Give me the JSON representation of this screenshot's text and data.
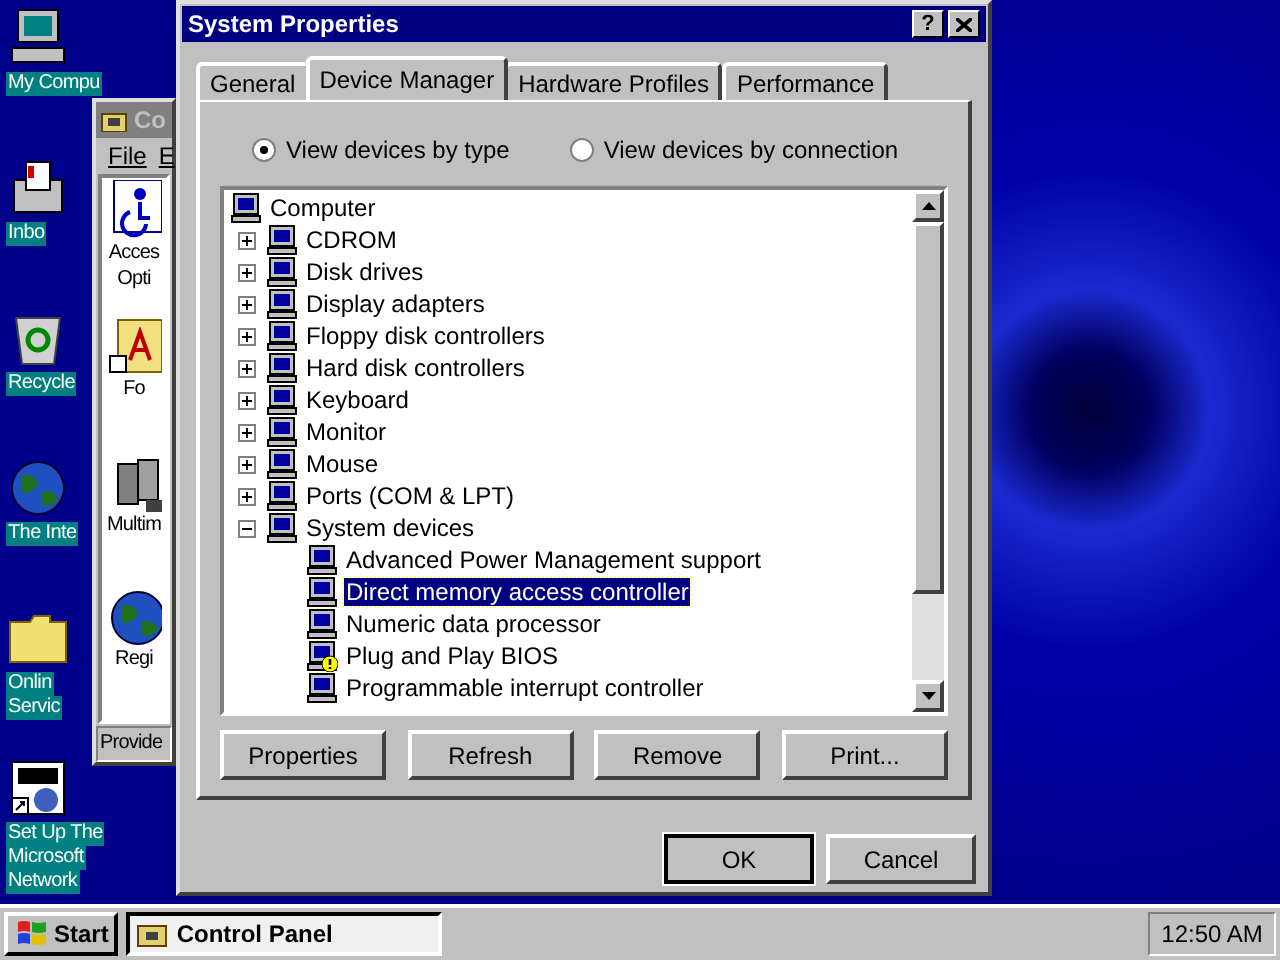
{
  "desktop_icons": [
    {
      "lines": [
        "My Compu"
      ]
    },
    {
      "lines": [
        "Inbo"
      ]
    },
    {
      "lines": [
        "Recycle"
      ]
    },
    {
      "lines": [
        "The Inte"
      ]
    },
    {
      "lines": [
        "Onlin",
        "Servic"
      ]
    },
    {
      "lines": [
        "Set Up The",
        "Microsoft",
        "Network"
      ]
    }
  ],
  "control_panel": {
    "title": "Co",
    "menu": [
      "File",
      "E"
    ],
    "items": [
      {
        "lines": [
          "Acces",
          "Opti"
        ]
      },
      {
        "lines": [
          "Fo"
        ]
      },
      {
        "lines": [
          "Multim"
        ]
      },
      {
        "lines": [
          "Regi"
        ]
      }
    ],
    "status": "Provide"
  },
  "window": {
    "title": "System Properties",
    "help": "?"
  },
  "tabs": [
    {
      "label": "General",
      "selected": false
    },
    {
      "label": "Device Manager",
      "selected": true
    },
    {
      "label": "Hardware Profiles",
      "selected": false
    },
    {
      "label": "Performance",
      "selected": false
    }
  ],
  "view_options": [
    {
      "label": "View devices by type",
      "selected": true
    },
    {
      "label": "View devices by connection",
      "selected": false
    }
  ],
  "tree": [
    {
      "label": "Computer",
      "selected": false,
      "children": [
        {
          "label": "CDROM",
          "expanded": false,
          "selected": false
        },
        {
          "label": "Disk drives",
          "expanded": false,
          "selected": false
        },
        {
          "label": "Display adapters",
          "expanded": false,
          "selected": false
        },
        {
          "label": "Floppy disk controllers",
          "expanded": false,
          "selected": false
        },
        {
          "label": "Hard disk controllers",
          "expanded": false,
          "selected": false
        },
        {
          "label": "Keyboard",
          "expanded": false,
          "selected": false
        },
        {
          "label": "Monitor",
          "expanded": false,
          "selected": false
        },
        {
          "label": "Mouse",
          "expanded": false,
          "selected": false
        },
        {
          "label": "Ports (COM & LPT)",
          "expanded": false,
          "selected": false
        },
        {
          "label": "System devices",
          "expanded": true,
          "selected": false,
          "children": [
            {
              "label": "Advanced Power Management support",
              "selected": false,
              "warning": false
            },
            {
              "label": "Direct memory access controller",
              "selected": true,
              "warning": false
            },
            {
              "label": "Numeric data processor",
              "selected": false,
              "warning": false
            },
            {
              "label": "Plug and Play BIOS",
              "selected": false,
              "warning": true
            },
            {
              "label": "Programmable interrupt controller",
              "selected": false,
              "warning": false
            }
          ]
        }
      ]
    }
  ],
  "device_buttons": [
    "Properties",
    "Refresh",
    "Remove",
    "Print..."
  ],
  "dialog_buttons": [
    "OK",
    "Cancel"
  ],
  "taskbar": {
    "start": "Start",
    "tasks": [
      {
        "label": "Control Panel",
        "selected": true
      }
    ],
    "clock": "12:50 AM"
  }
}
